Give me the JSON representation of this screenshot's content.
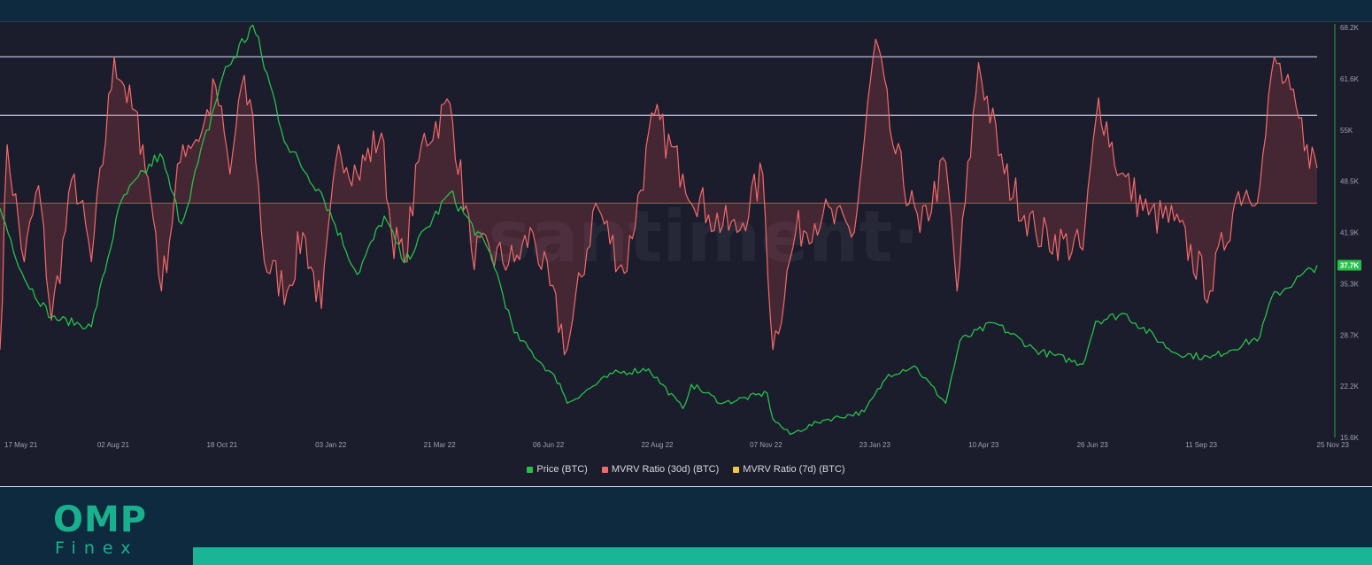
{
  "watermark": "·santiment·",
  "legend": [
    {
      "label": "Price (BTC)",
      "color": "#26c14b"
    },
    {
      "label": "MVRV Ratio (30d) (BTC)",
      "color": "#f26a6a"
    },
    {
      "label": "MVRV Ratio (7d) (BTC)",
      "color": "#f4c542"
    }
  ],
  "brand": {
    "name": "OMP",
    "sub": "Finex"
  },
  "chart_data": {
    "type": "line",
    "x_tick_labels": [
      "17 May 21",
      "02 Aug 21",
      "18 Oct 21",
      "03 Jan 22",
      "21 Mar 22",
      "06 Jun 22",
      "22 Aug 22",
      "07 Nov 22",
      "23 Jan 23",
      "10 Apr 23",
      "26 Jun 23",
      "11 Sep 23",
      "25 Nov 23"
    ],
    "x_range": [
      "2021-05-17",
      "2023-11-25"
    ],
    "price_axis": {
      "tick_labels": [
        "68.2K",
        "61.6K",
        "55K",
        "48.5K",
        "41.9K",
        "35.3K",
        "28.7K",
        "22.2K",
        "15.6K"
      ],
      "range": [
        15600,
        68200
      ],
      "last_value_label": "37.7K"
    },
    "mvrv_axis": {
      "range": [
        -0.4,
        0.3
      ],
      "visible": false
    },
    "reference_lines": [
      {
        "axis": "mvrv",
        "value": 0.25,
        "color": "#c9cde8"
      },
      {
        "axis": "mvrv",
        "value": 0.15,
        "color": "#c9cde8"
      },
      {
        "axis": "mvrv",
        "value": 0.0,
        "color": "#b34a4a"
      }
    ],
    "series": [
      {
        "name": "Price (BTC)",
        "axis": "price",
        "color": "#26c14b",
        "x": [
          "2021-05-17",
          "2021-06-03",
          "2021-06-22",
          "2021-07-20",
          "2021-08-10",
          "2021-09-06",
          "2021-09-21",
          "2021-10-20",
          "2021-11-10",
          "2021-12-04",
          "2021-12-28",
          "2022-01-22",
          "2022-02-10",
          "2022-02-24",
          "2022-03-28",
          "2022-04-26",
          "2022-05-12",
          "2022-06-13",
          "2022-06-18",
          "2022-07-20",
          "2022-08-14",
          "2022-09-07",
          "2022-09-13",
          "2022-10-05",
          "2022-11-05",
          "2022-11-09",
          "2022-11-21",
          "2022-12-14",
          "2023-01-12",
          "2023-01-29",
          "2023-02-16",
          "2023-03-10",
          "2023-03-20",
          "2023-04-13",
          "2023-05-12",
          "2023-06-14",
          "2023-06-23",
          "2023-07-13",
          "2023-08-17",
          "2023-09-11",
          "2023-10-16",
          "2023-10-24",
          "2023-11-25"
        ],
        "y": [
          45000,
          36000,
          31000,
          29800,
          46000,
          52000,
          43000,
          62000,
          68500,
          53000,
          47000,
          36500,
          44000,
          38000,
          47000,
          39000,
          29000,
          22500,
          20000,
          23800,
          24400,
          19300,
          22400,
          20000,
          21300,
          18000,
          16000,
          17800,
          18900,
          23700,
          24800,
          20000,
          28000,
          30300,
          26800,
          25000,
          30500,
          31500,
          26500,
          25800,
          28500,
          33500,
          37700
        ]
      },
      {
        "name": "MVRV Ratio (30d) (BTC)",
        "axis": "mvrv",
        "color": "#f26a6a",
        "x": [
          "2021-05-17",
          "2021-05-22",
          "2021-06-03",
          "2021-06-13",
          "2021-06-22",
          "2021-07-08",
          "2021-07-20",
          "2021-08-05",
          "2021-08-12",
          "2021-08-25",
          "2021-09-03",
          "2021-09-07",
          "2021-09-22",
          "2021-10-05",
          "2021-10-15",
          "2021-10-25",
          "2021-11-02",
          "2021-11-10",
          "2021-11-18",
          "2021-12-04",
          "2021-12-15",
          "2021-12-28",
          "2022-01-09",
          "2022-01-22",
          "2022-02-08",
          "2022-02-15",
          "2022-02-24",
          "2022-03-08",
          "2022-03-28",
          "2022-04-12",
          "2022-05-12",
          "2022-05-25",
          "2022-06-18",
          "2022-07-08",
          "2022-07-28",
          "2022-08-18",
          "2022-09-07",
          "2022-09-25",
          "2022-10-15",
          "2022-11-02",
          "2022-11-09",
          "2022-11-25",
          "2022-12-14",
          "2023-01-05",
          "2023-01-20",
          "2023-02-01",
          "2023-02-20",
          "2023-03-10",
          "2023-03-18",
          "2023-04-02",
          "2023-04-20",
          "2023-05-12",
          "2023-06-14",
          "2023-06-25",
          "2023-07-10",
          "2023-07-30",
          "2023-08-17",
          "2023-09-11",
          "2023-10-01",
          "2023-10-16",
          "2023-10-26",
          "2023-11-18",
          "2023-11-25"
        ],
        "y": [
          -0.25,
          0.1,
          -0.1,
          0.03,
          -0.2,
          0.05,
          -0.1,
          0.25,
          0.2,
          0.1,
          -0.05,
          -0.15,
          0.1,
          0.12,
          0.2,
          0.05,
          0.2,
          0.15,
          -0.1,
          -0.15,
          -0.05,
          -0.18,
          0.1,
          0.05,
          0.12,
          -0.05,
          -0.1,
          0.1,
          0.17,
          -0.08,
          -0.1,
          -0.05,
          -0.25,
          0.0,
          -0.12,
          0.15,
          0.05,
          -0.02,
          -0.05,
          0.05,
          -0.25,
          -0.05,
          -0.02,
          -0.05,
          0.28,
          0.1,
          -0.05,
          0.07,
          -0.15,
          0.24,
          0.05,
          -0.05,
          -0.08,
          0.18,
          0.05,
          -0.02,
          -0.03,
          -0.15,
          0.02,
          0.03,
          0.25,
          0.1,
          0.06
        ]
      }
    ]
  }
}
